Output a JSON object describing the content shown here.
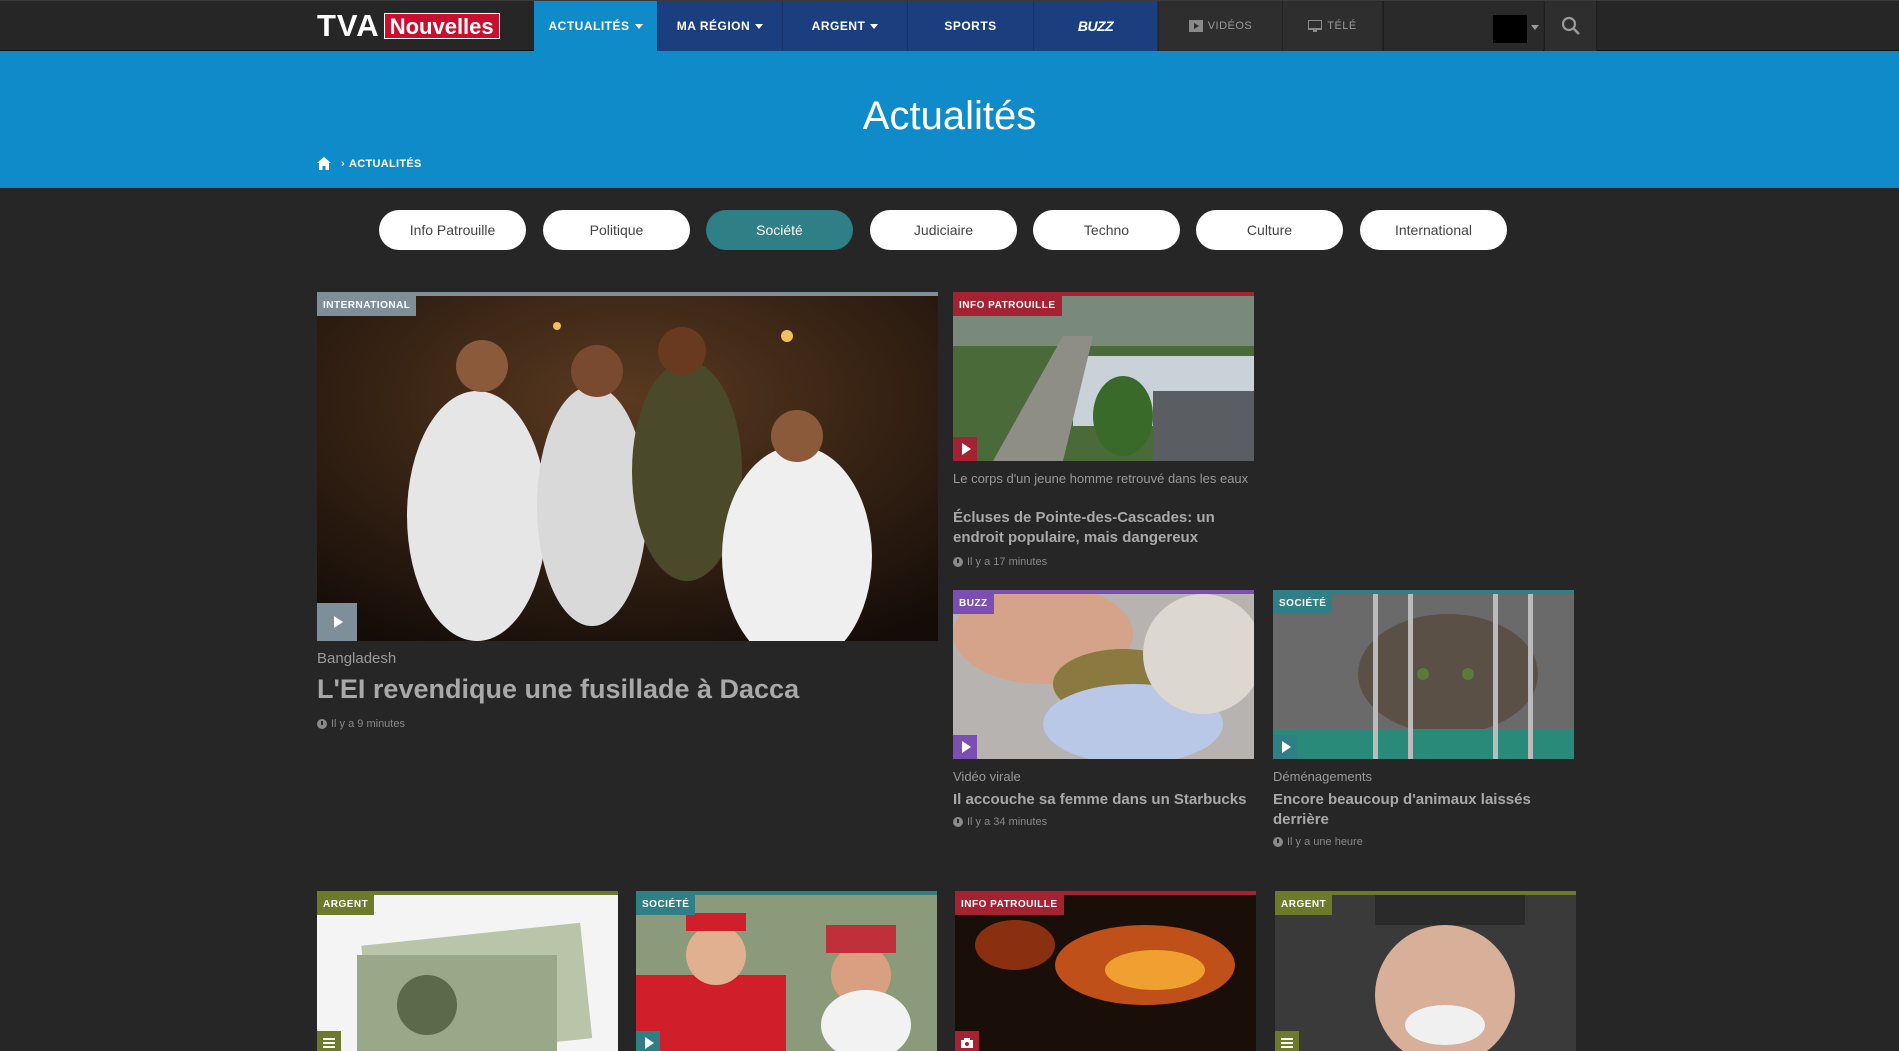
{
  "brand": {
    "logo_left": "TVA",
    "logo_right": "Nouvelles"
  },
  "nav": {
    "items": [
      {
        "label": "ACTUALITÉS"
      },
      {
        "label": "MA RÉGION"
      },
      {
        "label": "ARGENT"
      },
      {
        "label": "SPORTS"
      },
      {
        "label": "BUZZ"
      }
    ],
    "secondary": [
      {
        "label": "VIDÉOS",
        "icon": "play-icon"
      },
      {
        "label": "TÉLÉ",
        "icon": "tv-icon"
      }
    ]
  },
  "header": {
    "title": "Actualités",
    "breadcrumb": {
      "current": "ACTUALITÉS"
    }
  },
  "categories": [
    {
      "label": "Info Patrouille"
    },
    {
      "label": "Politique"
    },
    {
      "label": "Société",
      "active": true
    },
    {
      "label": "Judiciaire"
    },
    {
      "label": "Techno"
    },
    {
      "label": "Culture"
    },
    {
      "label": "International"
    }
  ],
  "articles": {
    "main": {
      "tag": "INTERNATIONAL",
      "kicker": "Bangladesh",
      "title": "L'EI revendique une fusillade à Dacca",
      "time": "Il y a 9 minutes",
      "color": "#7f8f9a"
    },
    "a1": {
      "tag": "INFO PATROUILLE",
      "kicker": "Le corps d'un jeune homme retrouvé dans les eaux",
      "title": "Écluses de Pointe-des-Cascades: un endroit populaire, mais dangereux",
      "time": "Il y a 17 minutes",
      "color": "#a52232"
    },
    "a2": {
      "tag": "BUZZ",
      "kicker": "Vidéo virale",
      "title": "Il accouche sa femme dans un Starbucks",
      "time": "Il y a 34 minutes",
      "color": "#7a4fb1"
    },
    "a3": {
      "tag": "SOCIÉTÉ",
      "kicker": "Déménagements",
      "title": "Encore beaucoup d'animaux laissés derrière",
      "time": "Il y a une heure",
      "color": "#2f7f86"
    },
    "b1": {
      "tag": "ARGENT",
      "color": "#6d7a2c"
    },
    "b2": {
      "tag": "SOCIÉTÉ",
      "color": "#2f7f86"
    },
    "b3": {
      "tag": "INFO PATROUILLE",
      "color": "#a52232"
    },
    "b4": {
      "tag": "ARGENT",
      "color": "#6d7a2c"
    }
  }
}
